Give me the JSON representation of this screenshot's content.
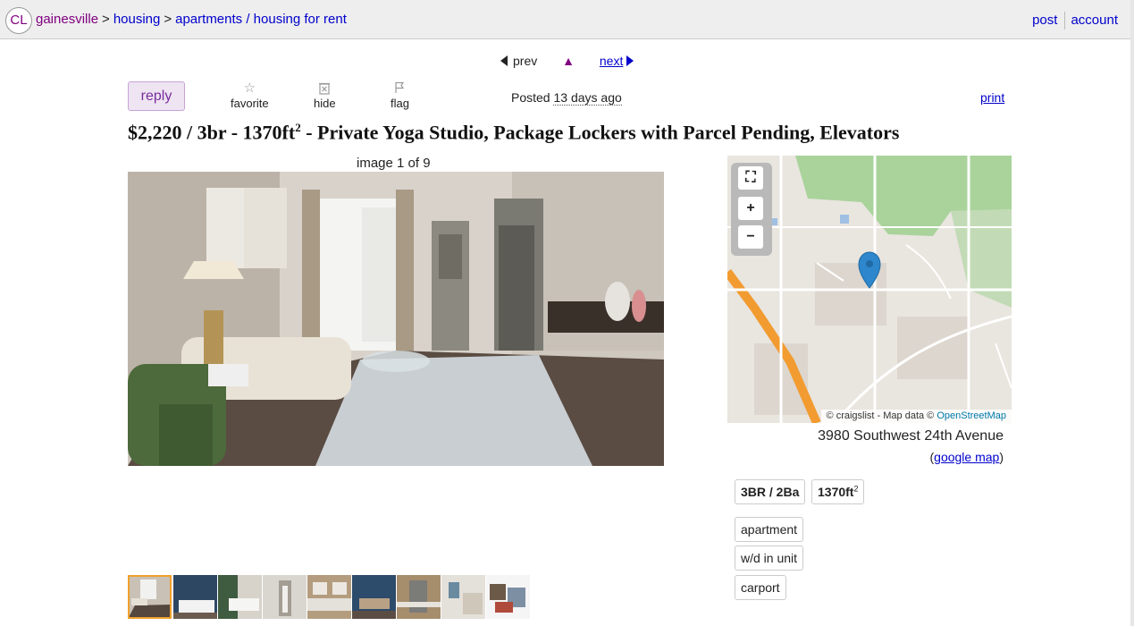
{
  "header": {
    "logo": "CL",
    "breadcrumb": [
      {
        "label": "gainesville"
      },
      {
        "label": "housing"
      },
      {
        "label": "apartments / housing for rent"
      }
    ],
    "separator": ">",
    "post": "post",
    "account": "account"
  },
  "pager": {
    "prev": "prev",
    "up": "▲",
    "next": "next"
  },
  "actions": {
    "reply": "reply",
    "favorite": "favorite",
    "hide": "hide",
    "flag": "flag",
    "posted_label": "Posted",
    "posted_ago": "13 days ago",
    "print": "print"
  },
  "listing": {
    "title_pre": "$2,220 / 3br - 1370ft",
    "title_sup": "2",
    "title_post": " - Private Yoga Studio, Package Lockers with Parcel Pending, Elevators",
    "image_counter": "image 1 of 9",
    "thumbnail_count": 9,
    "selected_thumbnail": 1
  },
  "map": {
    "attribution_prefix": "© craigslist - Map data ©",
    "attribution_link": "OpenStreetMap",
    "fullscreen": "⛶",
    "zoom_in": "+",
    "zoom_out": "−",
    "address": "3980 Southwest 24th Avenue",
    "google_map": "google map",
    "paren_open": "(",
    "paren_close": ")"
  },
  "attributes": {
    "br_ba": "3BR / 2Ba",
    "sqft": "1370ft",
    "sqft_sup": "2",
    "tags": [
      "apartment",
      "w/d in unit",
      "carport"
    ]
  },
  "colors": {
    "link": "#0000cc",
    "visited": "#800080",
    "reply_bg": "#eee4f2",
    "thumb_selected": "#f0a02c",
    "map_marker": "#2e87cc"
  }
}
